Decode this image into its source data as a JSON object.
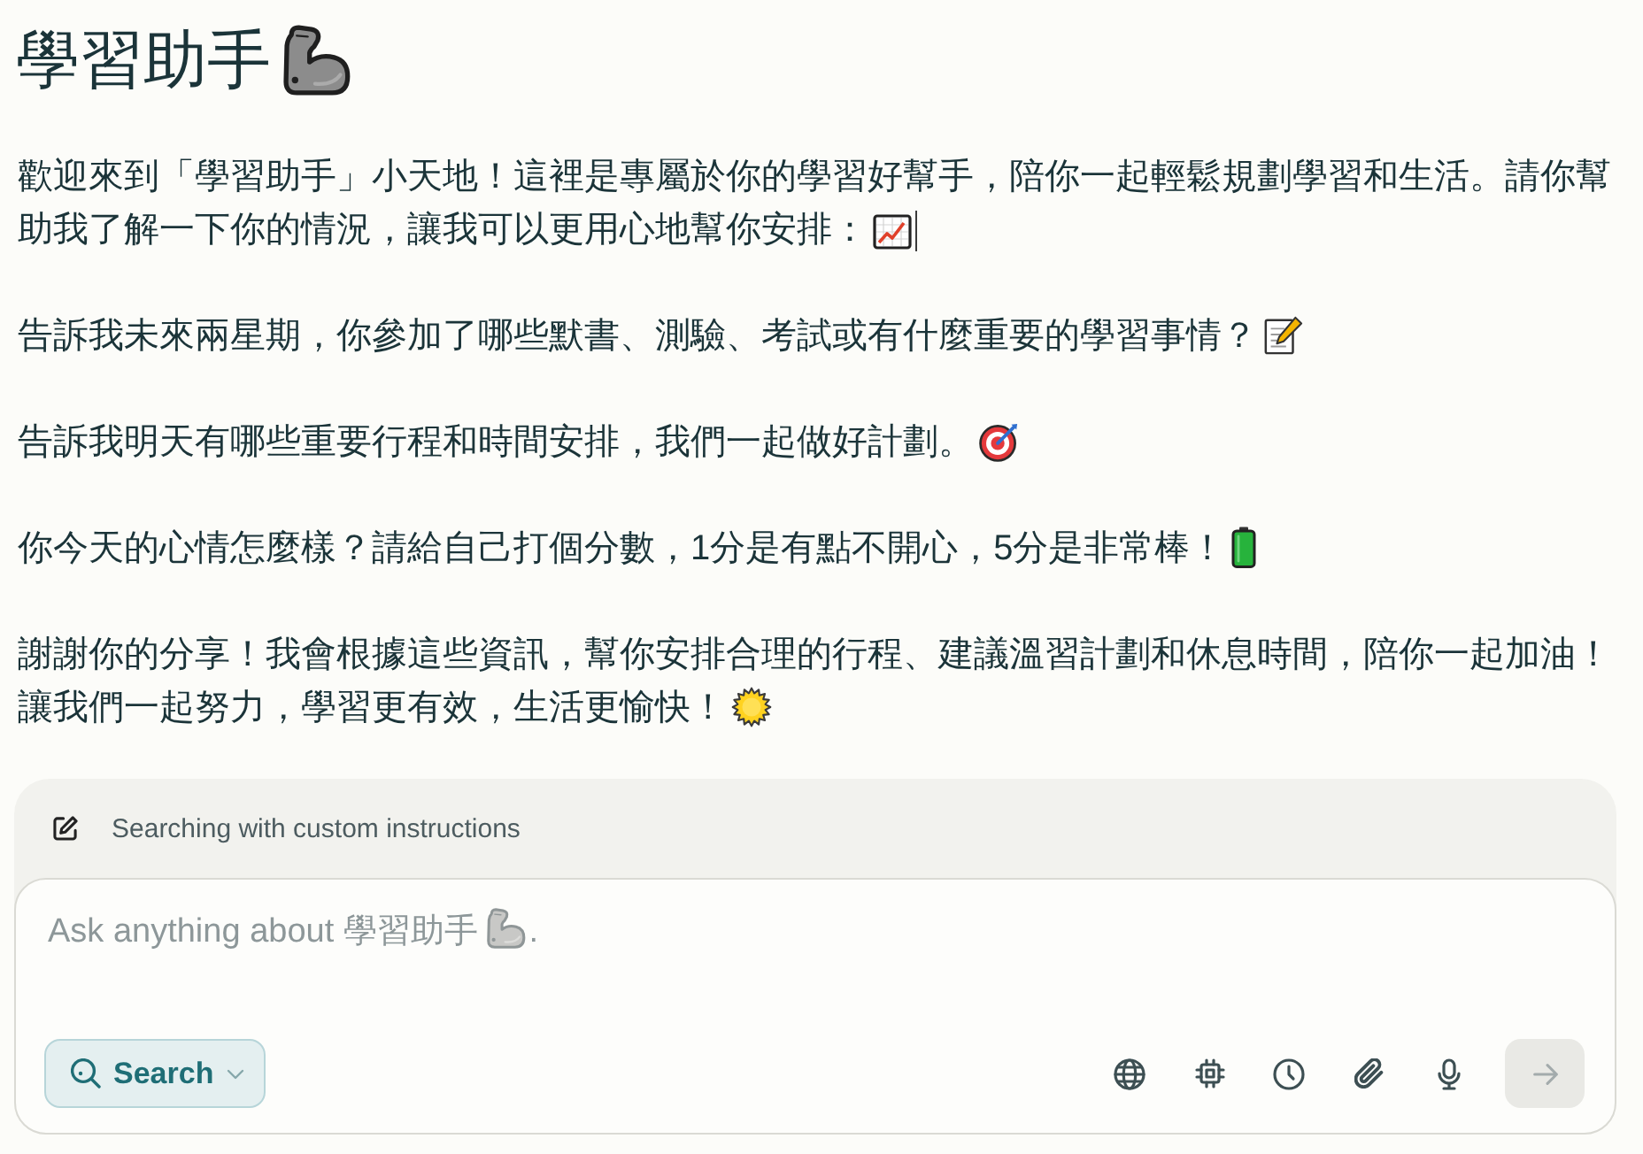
{
  "title": "學習助手",
  "paragraphs": [
    {
      "lines": [
        "歡迎來到「學習助手」小天地！這裡是專屬於你的學習好幫手，陪你一起輕鬆規劃學習和生活。請你幫",
        "助我了解一下你的情況，讓我可以更用心地幫你安排："
      ],
      "caret": true
    },
    {
      "lines": [
        "告訴我未來兩星期，你參加了哪些默書、測驗、考試或有什麼重要的學習事情？"
      ],
      "caret": false
    },
    {
      "lines": [
        "告訴我明天有哪些重要行程和時間安排，我們一起做好計劃。"
      ],
      "caret": false
    },
    {
      "lines": [
        "你今天的心情怎麼樣？請給自己打個分數，1分是有點不開心，5分是非常棒！"
      ],
      "caret": false
    },
    {
      "lines": [
        "謝謝你的分享！我會根據這些資訊，幫你安排合理的行程、建議溫習計劃和休息時間，陪你一起加油！",
        "讓我們一起努力，學習更有效，生活更愉快！"
      ],
      "caret": false
    }
  ],
  "composer": {
    "note": "Searching with custom instructions",
    "placeholder": "Ask anything about 學習助手",
    "placeholder_suffix": ".",
    "mode_button": {
      "label": "Search",
      "selected": true
    },
    "send_button": {
      "disabled": true
    }
  }
}
